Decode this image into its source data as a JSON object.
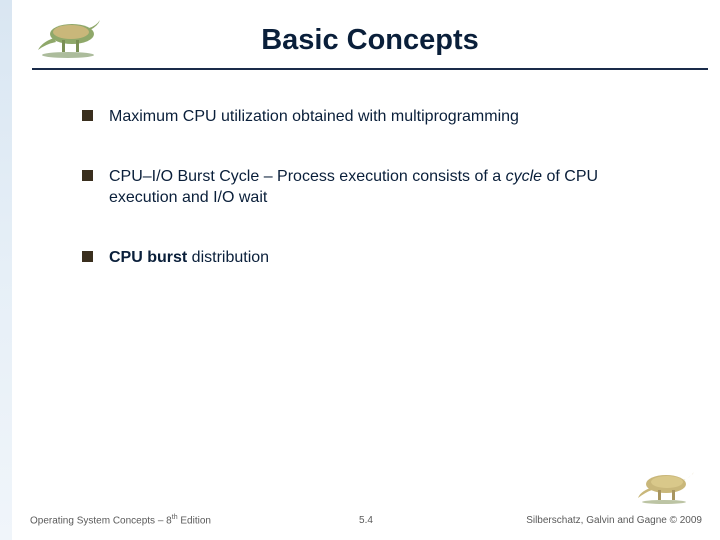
{
  "header": {
    "title": "Basic Concepts"
  },
  "bullets": [
    {
      "plain": "Maximum CPU utilization obtained with multiprogramming"
    },
    {
      "lead": "CPU–I/O Burst Cycle – Process execution consists of a ",
      "italic": "cycle",
      "tail": " of CPU execution and I/O wait"
    },
    {
      "bold": "CPU burst",
      "rest": " distribution"
    }
  ],
  "footer": {
    "left_a": "Operating System Concepts – 8",
    "left_sup": "th",
    "left_b": " Edition",
    "center": "5.4",
    "right": "Silberschatz, Galvin and Gagne © 2009"
  },
  "icons": {
    "dino_top": "dinosaur-illustration",
    "dino_bottom": "dinosaur-illustration-small"
  }
}
